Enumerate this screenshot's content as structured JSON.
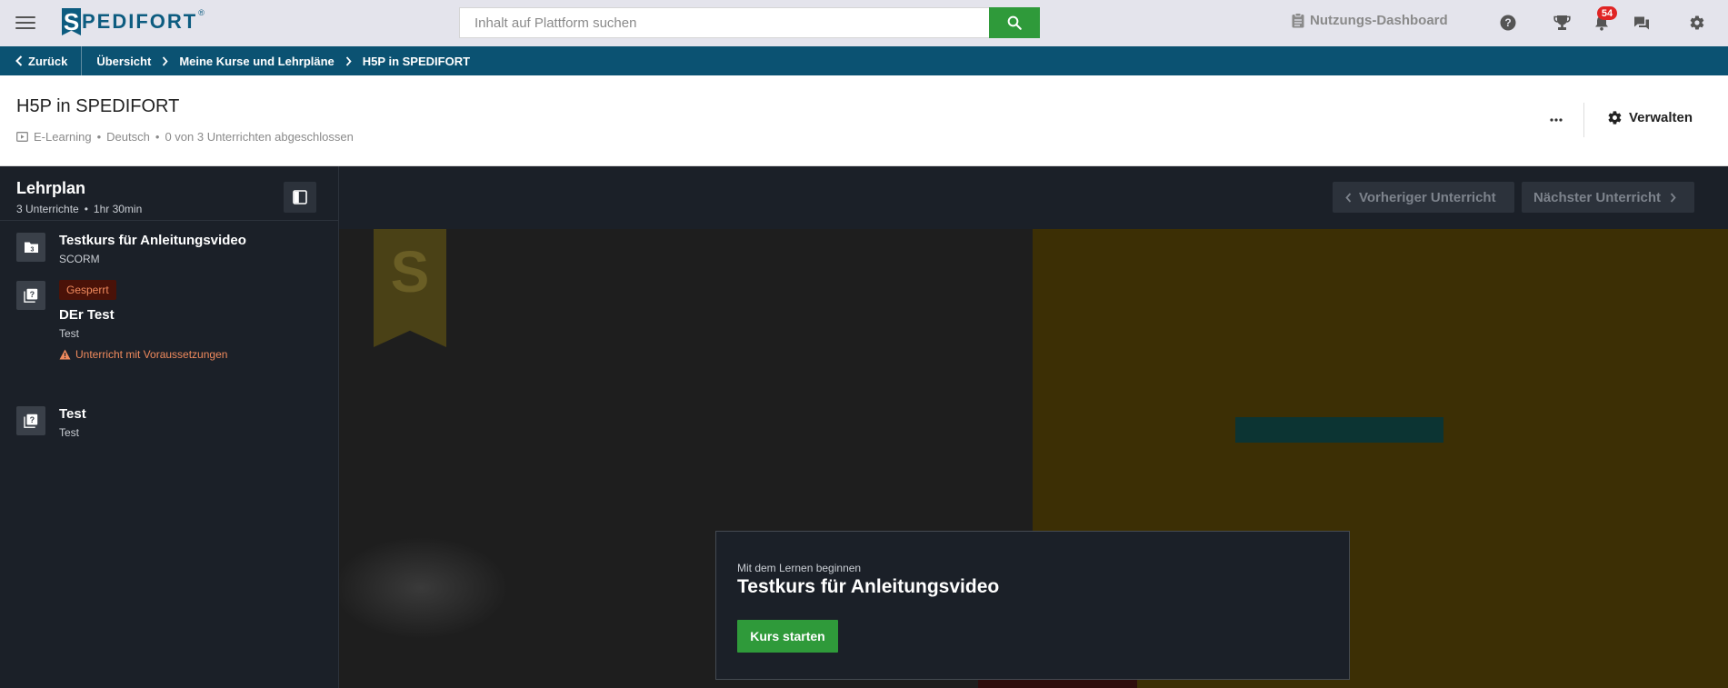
{
  "topbar": {
    "logo_letter": "S",
    "logo_text": "PEDIFORT",
    "logo_reg": "®",
    "search_placeholder": "Inhalt auf Plattform suchen",
    "dashboard_label": "Nutzungs-Dashboard",
    "notification_count": "54",
    "icons": [
      "menu-icon",
      "search-icon",
      "clipboard-icon",
      "help-icon",
      "trophy-icon",
      "bell-icon",
      "chat-icon",
      "gear-icon"
    ]
  },
  "breadcrumb": {
    "back_label": "Zurück",
    "items": [
      "Übersicht",
      "Meine Kurse und Lehrpläne",
      "H5P in SPEDIFORT"
    ]
  },
  "course": {
    "title": "H5P in SPEDIFORT",
    "type": "E-Learning",
    "language": "Deutsch",
    "progress_text": "0 von 3 Unterrichten abgeschlossen",
    "manage_label": "Verwalten"
  },
  "sidebar": {
    "title": "Lehrplan",
    "lesson_count": "3 Unterrichte",
    "duration": "1hr 30min",
    "lessons": [
      {
        "title": "Testkurs für Anleitungsvideo",
        "subtitle": "SCORM",
        "icon": "folder-icon"
      },
      {
        "badge": "Gesperrt",
        "title": "DEr Test",
        "subtitle": "Test",
        "warning": "Unterricht mit Voraussetzungen",
        "icon": "quiz-icon"
      },
      {
        "title": "Test",
        "subtitle": "Test",
        "icon": "quiz-icon"
      }
    ]
  },
  "content": {
    "prev_label": "Vorheriger Unterricht",
    "next_label": "Nächster Unterricht",
    "ribbon_letter": "S",
    "card_kicker": "Mit dem Lernen beginnen",
    "card_title": "Testkurs für Anleitungsvideo",
    "start_label": "Kurs starten"
  },
  "colors": {
    "brand": "#0d5c80",
    "breadcrumb_bg": "#0b5272",
    "accent_green": "#2f9a3a",
    "dark_bg": "#1b2028",
    "locked_text": "#f08a5d",
    "badge_red": "#e02424"
  }
}
